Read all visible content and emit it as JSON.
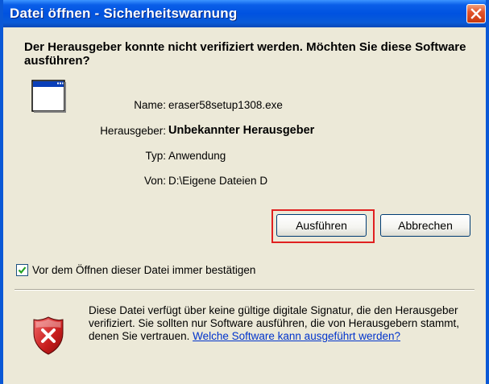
{
  "window": {
    "title": "Datei öffnen - Sicherheitswarnung"
  },
  "question": "Der Herausgeber konnte nicht verifiziert werden. Möchten Sie diese Software ausführen?",
  "fields": {
    "name_label": "Name:",
    "name_value": "eraser58setup1308.exe",
    "publisher_label": "Herausgeber:",
    "publisher_value": "Unbekannter Herausgeber",
    "type_label": "Typ:",
    "type_value": "Anwendung",
    "from_label": "Von:",
    "from_value": "D:\\Eigene Dateien D"
  },
  "buttons": {
    "run_label": "Ausführen",
    "cancel_label": "Abbrechen"
  },
  "checkbox": {
    "label": "Vor dem Öffnen dieser Datei immer bestätigen",
    "checked": true
  },
  "warning": {
    "text": "Diese Datei verfügt über keine gültige digitale Signatur, die den Herausgeber verifiziert. Sie sollten nur Software ausführen, die von Herausgebern stammt, denen Sie vertrauen.",
    "link_text": "Welche Software kann ausgeführt werden?"
  },
  "colors": {
    "titlebar": "#0052e0",
    "highlight_box": "#e02020",
    "link": "#0033cc",
    "shield": "#c81d1d"
  },
  "icons": {
    "close": "close-icon",
    "app": "application-window-icon",
    "check": "checkmark-icon",
    "shield": "security-shield-icon"
  }
}
